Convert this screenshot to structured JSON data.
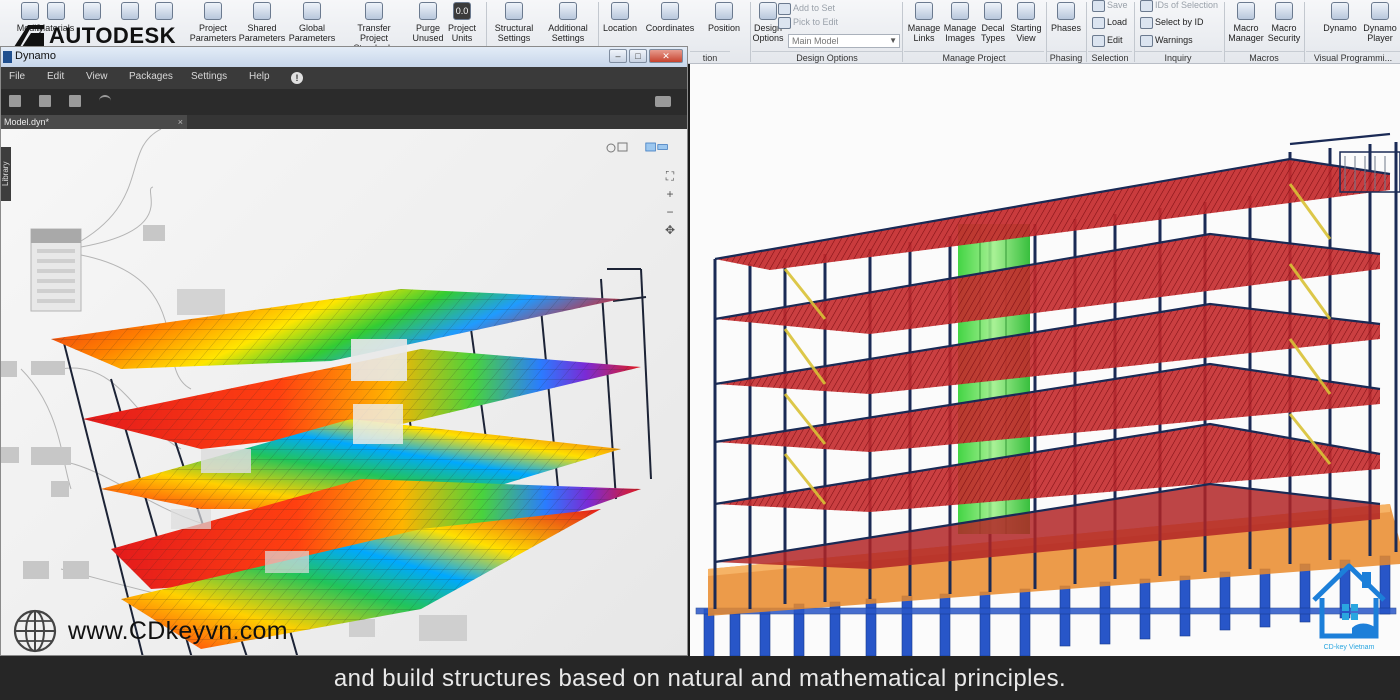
{
  "ribbon": {
    "buttons": [
      {
        "label": "Modify",
        "icon": "cursor-icon"
      },
      {
        "label": "Materials",
        "icon": "materials-sphere-icon"
      },
      {
        "label": "",
        "icon": "object-styles-icon"
      },
      {
        "label": "",
        "icon": "snaps-magnet-icon"
      },
      {
        "label": "",
        "icon": "project-info-icon"
      },
      {
        "label": "Project\nParameters",
        "icon": "project-parameters-icon"
      },
      {
        "label": "Shared\nParameters",
        "icon": "shared-parameters-icon"
      },
      {
        "label": "Global\nParameters",
        "icon": "global-parameters-icon"
      },
      {
        "label": "Transfer\nProject Standards",
        "icon": "transfer-standards-icon"
      },
      {
        "label": "Purge\nUnused",
        "icon": "purge-icon"
      },
      {
        "label": "Project\nUnits",
        "icon": "units-icon"
      },
      {
        "label": "Structural\nSettings",
        "icon": "structural-settings-icon"
      },
      {
        "label": "Additional\nSettings",
        "icon": "wrench-icon"
      },
      {
        "label": "Location",
        "icon": "globe-location-icon"
      },
      {
        "label": "Coordinates",
        "icon": "coordinates-icon"
      },
      {
        "label": "Position",
        "icon": "position-icon"
      },
      {
        "label": "Design\nOptions",
        "icon": "design-options-icon"
      },
      {
        "label": "Manage\nLinks",
        "icon": "manage-links-icon"
      },
      {
        "label": "Manage\nImages",
        "icon": "manage-images-icon"
      },
      {
        "label": "Decal\nTypes",
        "icon": "decal-types-icon"
      },
      {
        "label": "Starting\nView",
        "icon": "starting-view-icon"
      },
      {
        "label": "Phases",
        "icon": "phases-icon"
      },
      {
        "label": "Macro\nManager",
        "icon": "macro-manager-icon"
      },
      {
        "label": "Macro\nSecurity",
        "icon": "macro-security-icon"
      },
      {
        "label": "Dynamo",
        "icon": "dynamo-icon"
      },
      {
        "label": "Dynamo\nPlayer",
        "icon": "dynamo-player-icon"
      }
    ],
    "units_readout": "0.0",
    "small_buttons": {
      "add_to_set": "Add to Set",
      "pick_to_edit": "Pick to Edit",
      "save": "Save",
      "load": "Load",
      "edit": "Edit",
      "ids_of_selection": "IDs of Selection",
      "select_by_id": "Select by ID",
      "warnings": "Warnings"
    },
    "design_option_value": "Main Model",
    "groups": {
      "settings": "",
      "location": "tion",
      "design_options": "Design Options",
      "manage_project": "Manage Project",
      "phasing": "Phasing",
      "selection": "Selection",
      "inquiry": "Inquiry",
      "macros": "Macros",
      "visual_programming": "Visual Programmi..."
    }
  },
  "logo": {
    "wordmark": "AUTODESK"
  },
  "dynamo": {
    "title": "Dynamo",
    "window_controls": [
      "–",
      "□",
      "✕"
    ],
    "menu": [
      "File",
      "Edit",
      "View",
      "Packages",
      "Settings",
      "Help"
    ],
    "file_tab": "Model.dyn*",
    "file_tab_close": "×",
    "library_label": "Library",
    "zoom": {
      "fit": "⛶",
      "in": "+",
      "out": "−",
      "pan": "✥"
    }
  },
  "overlay": {
    "website": "www.CDkeyvn.com",
    "caption": "and build structures based on natural and mathematical principles.",
    "brand_caption": "CD-key Vietnam"
  },
  "colors": {
    "steel_frame": "#1a2a55",
    "beams": "#b8282a",
    "core": "#37d43a",
    "foundation": "#e9892a",
    "piles": "#2856c8",
    "brand_blue": "#1c7fd9"
  }
}
